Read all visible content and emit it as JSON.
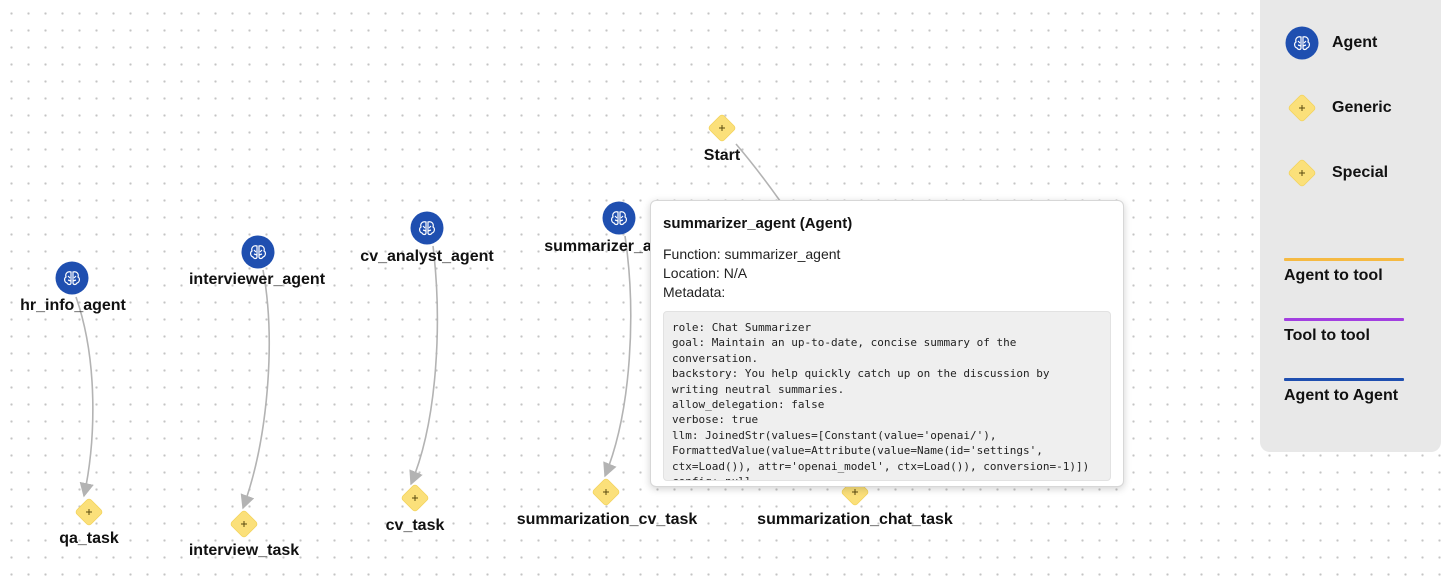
{
  "nodes": [
    {
      "id": "start",
      "label": "Start",
      "kind": "special"
    },
    {
      "id": "hr_info_agent",
      "label": "hr_info_agent",
      "kind": "agent"
    },
    {
      "id": "interviewer_agent",
      "label": "interviewer_agent",
      "kind": "agent"
    },
    {
      "id": "cv_analyst_agent",
      "label": "cv_analyst_agent",
      "kind": "agent"
    },
    {
      "id": "summarizer_agent",
      "label": "summarizer_a",
      "kind": "agent"
    },
    {
      "id": "qa_task",
      "label": "qa_task",
      "kind": "generic"
    },
    {
      "id": "interview_task",
      "label": "interview_task",
      "kind": "generic"
    },
    {
      "id": "cv_task",
      "label": "cv_task",
      "kind": "generic"
    },
    {
      "id": "summarization_cv_task",
      "label": "summarization_cv_task",
      "kind": "generic"
    },
    {
      "id": "summarization_chat_task",
      "label": "summarization_chat_task",
      "kind": "generic"
    }
  ],
  "edges": [
    {
      "from": "hr_info_agent",
      "to": "qa_task"
    },
    {
      "from": "interviewer_agent",
      "to": "interview_task"
    },
    {
      "from": "cv_analyst_agent",
      "to": "cv_task"
    },
    {
      "from": "summarizer_agent",
      "to": "summarization_cv_task"
    },
    {
      "from": "start",
      "to": "summarization_chat_task"
    }
  ],
  "tooltip": {
    "title": "summarizer_agent (Agent)",
    "function_label": "Function:",
    "function_value": "summarizer_agent",
    "location_label": "Location:",
    "location_value": "N/A",
    "metadata_label": "Metadata:",
    "metadata": "role: Chat Summarizer\ngoal: Maintain an up-to-date, concise summary of the conversation.\nbackstory: You help quickly catch up on the discussion by writing neutral summaries.\nallow_delegation: false\nverbose: true\nllm: JoinedStr(values=[Constant(value='openai/'), FormattedValue(value=Attribute(value=Name(id='settings', ctx=Load()), attr='openai_model', ctx=Load()), conversion=-1)])\nconfig: null"
  },
  "legend": {
    "nodes": [
      {
        "label": "Agent",
        "kind": "agent"
      },
      {
        "label": "Generic",
        "kind": "generic"
      },
      {
        "label": "Special",
        "kind": "special"
      }
    ],
    "edges": [
      {
        "label": "Agent to tool",
        "color": "#f5b942"
      },
      {
        "label": "Tool to tool",
        "color": "#a23fe0"
      },
      {
        "label": "Agent to Agent",
        "color": "#1f4fb0"
      }
    ]
  },
  "colors": {
    "agent": "#1f4fb0",
    "generic": "#fbe07a",
    "edge": "#b3b3b3"
  }
}
